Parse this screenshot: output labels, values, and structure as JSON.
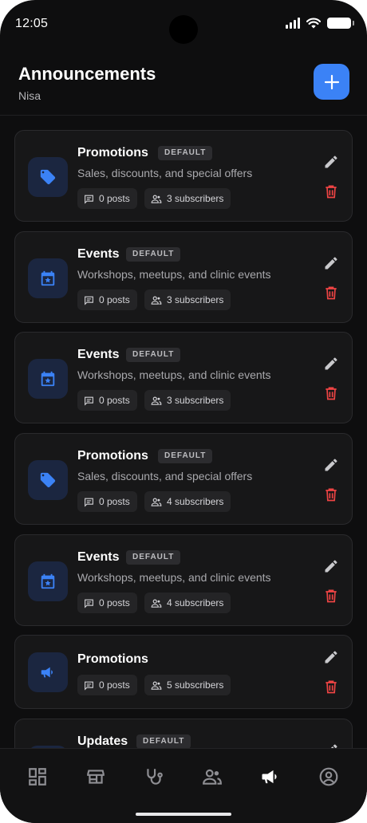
{
  "status_bar": {
    "time": "12:05"
  },
  "header": {
    "title": "Announcements",
    "subtitle": "Nisa",
    "add_icon": "plus-icon"
  },
  "colors": {
    "accent": "#3b82f6",
    "danger": "#ef4444",
    "background": "#0e0e0f",
    "card": "#171718"
  },
  "channels": [
    {
      "name": "Promotions",
      "badge": "DEFAULT",
      "description": "Sales, discounts, and special offers",
      "posts": "0 posts",
      "subscribers": "3 subscribers",
      "icon": "tag-icon"
    },
    {
      "name": "Events",
      "badge": "DEFAULT",
      "description": "Workshops, meetups, and clinic events",
      "posts": "0 posts",
      "subscribers": "3 subscribers",
      "icon": "calendar-star-icon"
    },
    {
      "name": "Events",
      "badge": "DEFAULT",
      "description": "Workshops, meetups, and clinic events",
      "posts": "0 posts",
      "subscribers": "3 subscribers",
      "icon": "calendar-star-icon"
    },
    {
      "name": "Promotions",
      "badge": "DEFAULT",
      "description": "Sales, discounts, and special offers",
      "posts": "0 posts",
      "subscribers": "4 subscribers",
      "icon": "tag-icon"
    },
    {
      "name": "Events",
      "badge": "DEFAULT",
      "description": "Workshops, meetups, and clinic events",
      "posts": "0 posts",
      "subscribers": "4 subscribers",
      "icon": "calendar-star-icon"
    },
    {
      "name": "Promotions",
      "posts": "0 posts",
      "subscribers": "5 subscribers",
      "icon": "megaphone-icon"
    },
    {
      "name": "Updates",
      "badge": "DEFAULT",
      "icon": "megaphone-icon"
    }
  ],
  "bottom_nav": [
    {
      "icon": "dashboard-icon",
      "active": false
    },
    {
      "icon": "store-icon",
      "active": false
    },
    {
      "icon": "stethoscope-icon",
      "active": false
    },
    {
      "icon": "people-icon",
      "active": false
    },
    {
      "icon": "megaphone-icon",
      "active": true
    },
    {
      "icon": "account-circle-icon",
      "active": false
    }
  ]
}
